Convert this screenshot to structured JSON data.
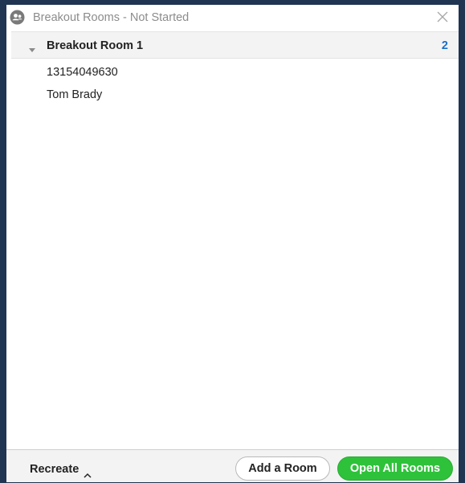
{
  "window": {
    "title": "Breakout Rooms - Not Started",
    "app_icon": "breakout-rooms-icon",
    "close_icon": "close-icon"
  },
  "rooms": [
    {
      "name": "Breakout Room 1",
      "count": "2",
      "expanded": true,
      "participants": [
        "13154049630",
        "Tom Brady"
      ]
    }
  ],
  "footer": {
    "recreate_label": "Recreate",
    "add_room_label": "Add a Room",
    "open_all_label": "Open All Rooms"
  },
  "colors": {
    "outer_background": "#1f3552",
    "accent_green": "#2ec23a",
    "count_blue": "#1a6fc6",
    "title_gray": "#8c8c8c"
  }
}
